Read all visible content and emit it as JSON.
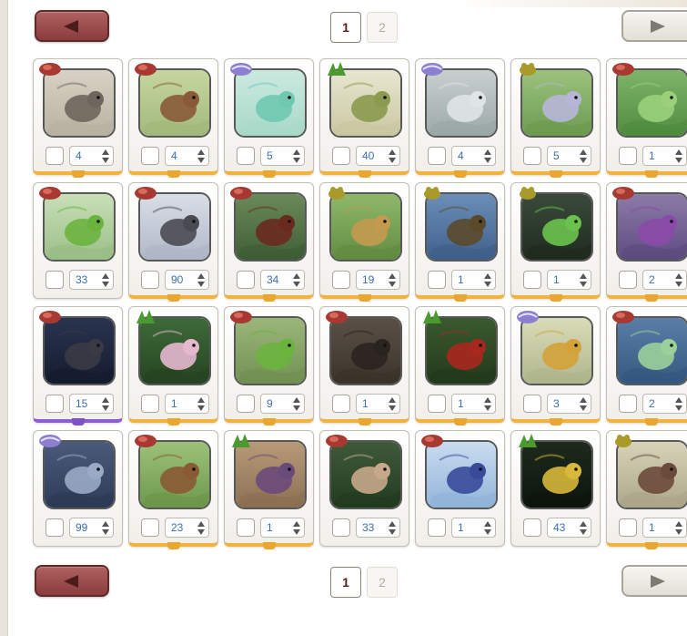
{
  "pagination": {
    "current_page": "1",
    "other_page": "2"
  },
  "palette": {
    "badge_red": "#a63a32",
    "badge_green": "#4a9a2e",
    "badge_purple": "#8d7fd0",
    "badge_olive": "#a99a2a",
    "underline_gold": "#f0b33e",
    "underline_purple": "#8a5ed0"
  },
  "items": [
    {
      "subject": "squirrel",
      "badge": "red",
      "qty": "4",
      "underline": "gold"
    },
    {
      "subject": "mouse",
      "badge": "red",
      "qty": "4",
      "underline": "gold"
    },
    {
      "subject": "jellyfish",
      "badge": "purple",
      "qty": "5",
      "underline": "gold"
    },
    {
      "subject": "grass",
      "badge": "green",
      "qty": "40",
      "underline": "gold"
    },
    {
      "subject": "silver-fish",
      "badge": "purple",
      "qty": "4",
      "underline": "gold"
    },
    {
      "subject": "ant",
      "badge": "olive",
      "qty": "5",
      "underline": "gold"
    },
    {
      "subject": "frog",
      "badge": "red",
      "qty": "1",
      "underline": "gold"
    },
    {
      "subject": "green-bird",
      "badge": "red",
      "qty": "33",
      "underline": "none"
    },
    {
      "subject": "chickadee",
      "badge": "red",
      "qty": "90",
      "underline": "gold"
    },
    {
      "subject": "salamander",
      "badge": "red",
      "qty": "34",
      "underline": "gold"
    },
    {
      "subject": "spider",
      "badge": "olive",
      "qty": "19",
      "underline": "gold"
    },
    {
      "subject": "water-strider",
      "badge": "olive",
      "qty": "1",
      "underline": "gold"
    },
    {
      "subject": "katydid",
      "badge": "olive",
      "qty": "1",
      "underline": "gold"
    },
    {
      "subject": "purple-bird",
      "badge": "red",
      "qty": "2",
      "underline": "gold"
    },
    {
      "subject": "shrew",
      "badge": "red",
      "qty": "15",
      "underline": "purple"
    },
    {
      "subject": "lily-pads",
      "badge": "green",
      "qty": "1",
      "underline": "gold"
    },
    {
      "subject": "lizard",
      "badge": "red",
      "qty": "9",
      "underline": "gold"
    },
    {
      "subject": "mole",
      "badge": "red",
      "qty": "1",
      "underline": "gold"
    },
    {
      "subject": "red-flower",
      "badge": "green",
      "qty": "1",
      "underline": "gold"
    },
    {
      "subject": "mushrooms",
      "badge": "purple",
      "qty": "3",
      "underline": "gold"
    },
    {
      "subject": "owl",
      "badge": "red",
      "qty": "2",
      "underline": "gold"
    },
    {
      "subject": "fish-pile",
      "badge": "purple",
      "qty": "99",
      "underline": "none"
    },
    {
      "subject": "fawn",
      "badge": "red",
      "qty": "23",
      "underline": "gold"
    },
    {
      "subject": "flower-bundle",
      "badge": "green",
      "qty": "1",
      "underline": "gold"
    },
    {
      "subject": "rooster",
      "badge": "red",
      "qty": "33",
      "underline": "none"
    },
    {
      "subject": "blue-bird",
      "badge": "red",
      "qty": "1",
      "underline": "none"
    },
    {
      "subject": "yellow-pepper",
      "badge": "green",
      "qty": "43",
      "underline": "none"
    },
    {
      "subject": "moth",
      "badge": "olive",
      "qty": "1",
      "underline": "gold"
    }
  ]
}
